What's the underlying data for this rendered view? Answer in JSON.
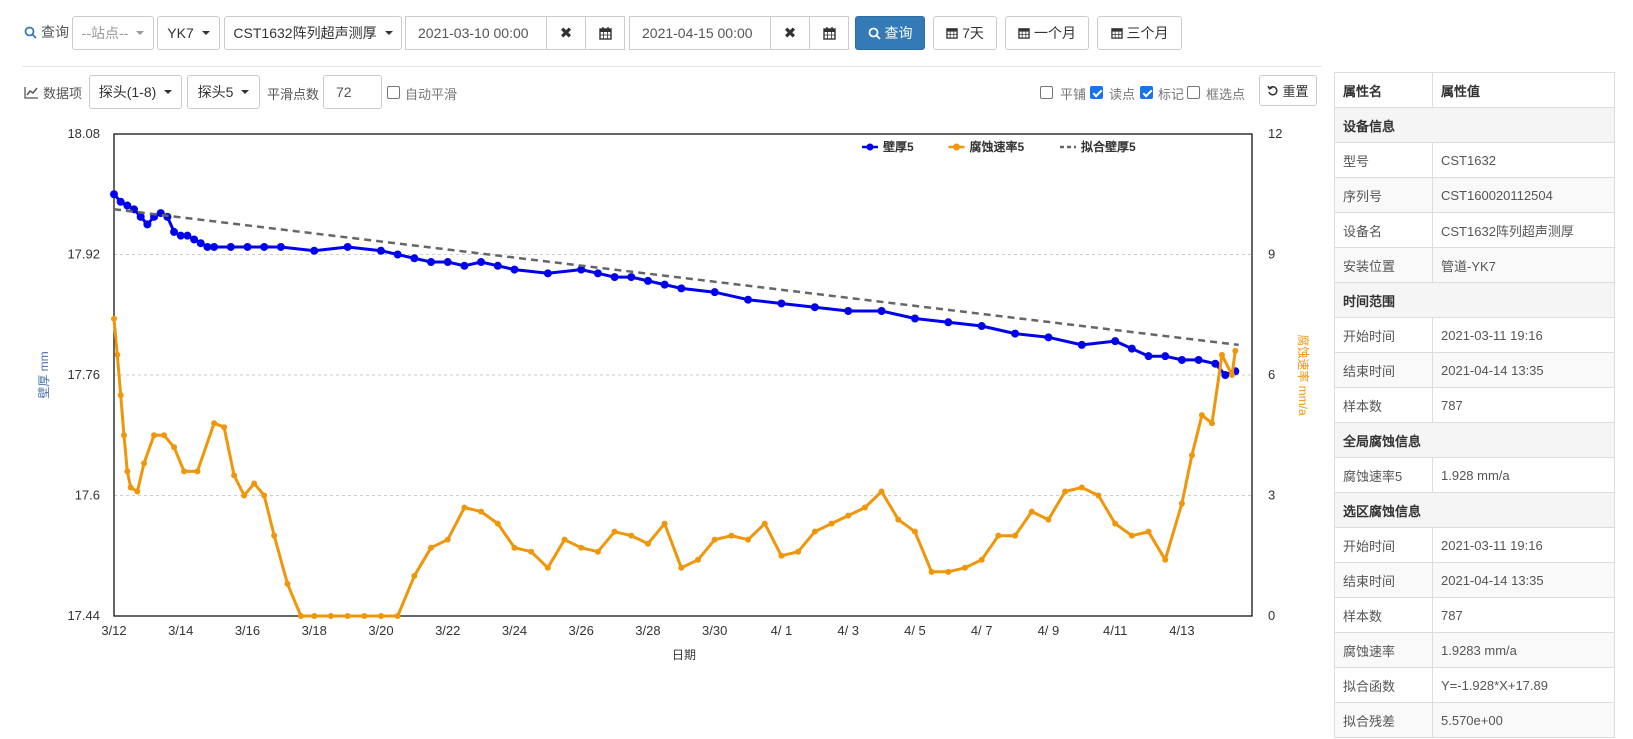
{
  "toolbar": {
    "query_label": "查询",
    "station_placeholder": "--站点--",
    "device_value": "YK7",
    "type_value": "CST1632阵列超声测厚",
    "start_date": "2021-03-10 00:00",
    "end_date": "2021-04-15 00:00",
    "search_button": "查询",
    "range_7d": "7天",
    "range_1m": "一个月",
    "range_3m": "三个月"
  },
  "data_toolbar": {
    "data_item_label": "数据项",
    "probe_group": "探头(1-8)",
    "probe": "探头5",
    "smooth_points_label": "平滑点数",
    "smooth_points_value": "72",
    "auto_smooth_label": "自动平滑",
    "tile_label": "平铺",
    "read_points_label": "读点",
    "mark_label": "标记",
    "box_select_label": "框选点",
    "reset_button": "重置",
    "tile_checked": false,
    "read_points_checked": true,
    "mark_checked": true,
    "box_select_checked": false,
    "auto_smooth_checked": false
  },
  "properties": {
    "header_name": "属性名",
    "header_value": "属性值",
    "sections": [
      {
        "title": "设备信息",
        "rows": [
          {
            "k": "型号",
            "v": "CST1632"
          },
          {
            "k": "序列号",
            "v": "CST160020112504"
          },
          {
            "k": "设备名",
            "v": "CST1632阵列超声测厚"
          },
          {
            "k": "安装位置",
            "v": "管道-YK7"
          }
        ]
      },
      {
        "title": "时间范围",
        "rows": [
          {
            "k": "开始时间",
            "v": "2021-03-11 19:16"
          },
          {
            "k": "结束时间",
            "v": "2021-04-14 13:35"
          },
          {
            "k": "样本数",
            "v": "787"
          }
        ]
      },
      {
        "title": "全局腐蚀信息",
        "rows": [
          {
            "k": "腐蚀速率5",
            "v": "1.928 mm/a"
          }
        ]
      },
      {
        "title": "选区腐蚀信息",
        "rows": [
          {
            "k": "开始时间",
            "v": "2021-03-11 19:16"
          },
          {
            "k": "结束时间",
            "v": "2021-04-14 13:35"
          },
          {
            "k": "样本数",
            "v": "787"
          },
          {
            "k": "腐蚀速率",
            "v": "1.9283 mm/a"
          },
          {
            "k": "拟合函数",
            "v": "Y=-1.928*X+17.89"
          },
          {
            "k": "拟合残差",
            "v": "5.570e+00"
          }
        ]
      }
    ]
  },
  "chart_data": {
    "type": "line",
    "xlabel": "日期",
    "ylabel_left": "壁厚 mm",
    "ylabel_right": "腐蚀速率 mm/a",
    "x_ticks": [
      "3/12",
      "3/14",
      "3/16",
      "3/18",
      "3/20",
      "3/22",
      "3/24",
      "3/26",
      "3/28",
      "3/30",
      "4/ 1",
      "4/ 3",
      "4/ 5",
      "4/ 7",
      "4/ 9",
      "4/11",
      "4/13"
    ],
    "y_left_ticks": [
      "18.08",
      "17.92",
      "17.76",
      "17.6",
      "17.44"
    ],
    "y_right_ticks": [
      "12",
      "9",
      "6",
      "3",
      "0"
    ],
    "ylim_left": [
      17.44,
      18.08
    ],
    "ylim_right": [
      0,
      12
    ],
    "grid": true,
    "legend_position": "top-right",
    "series": [
      {
        "name": "壁厚5",
        "axis": "left",
        "color": "#0000ee",
        "x": [
          0,
          0.2,
          0.4,
          0.6,
          0.8,
          1.0,
          1.2,
          1.4,
          1.6,
          1.8,
          2.0,
          2.2,
          2.4,
          2.6,
          2.8,
          3.0,
          3.5,
          4.0,
          4.5,
          5.0,
          6.0,
          7.0,
          8.0,
          8.5,
          9.0,
          9.5,
          10.0,
          10.5,
          11.0,
          11.5,
          12.0,
          13.0,
          14.0,
          14.5,
          15.0,
          15.5,
          16.0,
          16.5,
          17.0,
          18.0,
          19.0,
          20.0,
          21.0,
          22.0,
          23.0,
          24.0,
          25.0,
          26.0,
          27.0,
          28.0,
          29.0,
          30.0,
          30.5,
          31.0,
          31.5,
          32.0,
          32.5,
          33.0,
          33.3,
          33.6
        ],
        "y": [
          18.0,
          17.99,
          17.985,
          17.98,
          17.97,
          17.96,
          17.97,
          17.975,
          17.97,
          17.95,
          17.945,
          17.945,
          17.94,
          17.935,
          17.93,
          17.93,
          17.93,
          17.93,
          17.93,
          17.93,
          17.925,
          17.93,
          17.925,
          17.92,
          17.915,
          17.91,
          17.91,
          17.905,
          17.91,
          17.905,
          17.9,
          17.895,
          17.9,
          17.895,
          17.89,
          17.89,
          17.885,
          17.88,
          17.875,
          17.87,
          17.86,
          17.855,
          17.85,
          17.845,
          17.845,
          17.835,
          17.83,
          17.825,
          17.815,
          17.81,
          17.8,
          17.805,
          17.795,
          17.785,
          17.785,
          17.78,
          17.78,
          17.775,
          17.76,
          17.765
        ]
      },
      {
        "name": "腐蚀速率5",
        "axis": "right",
        "color": "#f0960a",
        "x": [
          0,
          0.1,
          0.2,
          0.3,
          0.4,
          0.5,
          0.7,
          0.9,
          1.2,
          1.5,
          1.8,
          2.1,
          2.5,
          3.0,
          3.3,
          3.6,
          3.9,
          4.2,
          4.5,
          4.8,
          5.2,
          5.6,
          6.0,
          6.5,
          7.0,
          7.5,
          8.0,
          8.5,
          9.0,
          9.5,
          10.0,
          10.5,
          11.0,
          11.5,
          12.0,
          12.5,
          13.0,
          13.5,
          14.0,
          14.5,
          15.0,
          15.5,
          16.0,
          16.5,
          17.0,
          17.5,
          18.0,
          18.5,
          19.0,
          19.5,
          20.0,
          20.5,
          21.0,
          21.5,
          22.0,
          22.5,
          23.0,
          23.5,
          24.0,
          24.5,
          25.0,
          25.5,
          26.0,
          26.5,
          27.0,
          27.5,
          28.0,
          28.5,
          29.0,
          29.5,
          30.0,
          30.5,
          31.0,
          31.5,
          32.0,
          32.3,
          32.6,
          32.9,
          33.2,
          33.5,
          33.6
        ],
        "y": [
          7.4,
          6.5,
          5.5,
          4.5,
          3.6,
          3.2,
          3.1,
          3.8,
          4.5,
          4.5,
          4.2,
          3.6,
          3.6,
          4.8,
          4.7,
          3.5,
          3.0,
          3.3,
          3.0,
          2.0,
          0.8,
          0.0,
          0.0,
          0.0,
          0.0,
          0.0,
          0.0,
          0.0,
          1.0,
          1.7,
          1.9,
          2.7,
          2.6,
          2.3,
          1.7,
          1.6,
          1.2,
          1.9,
          1.7,
          1.6,
          2.1,
          2.0,
          1.8,
          2.3,
          1.2,
          1.4,
          1.9,
          2.0,
          1.9,
          2.3,
          1.5,
          1.6,
          2.1,
          2.3,
          2.5,
          2.7,
          3.1,
          2.4,
          2.1,
          1.1,
          1.1,
          1.2,
          1.4,
          2.0,
          2.0,
          2.6,
          2.4,
          3.1,
          3.2,
          3.0,
          2.3,
          2.0,
          2.1,
          1.4,
          2.8,
          4.0,
          5.0,
          4.8,
          6.5,
          6.0,
          6.6
        ]
      },
      {
        "name": "拟合壁厚5",
        "axis": "left",
        "color": "#666666",
        "dashed": true,
        "x": [
          0,
          33.7
        ],
        "y": [
          17.98,
          17.8
        ]
      }
    ]
  }
}
